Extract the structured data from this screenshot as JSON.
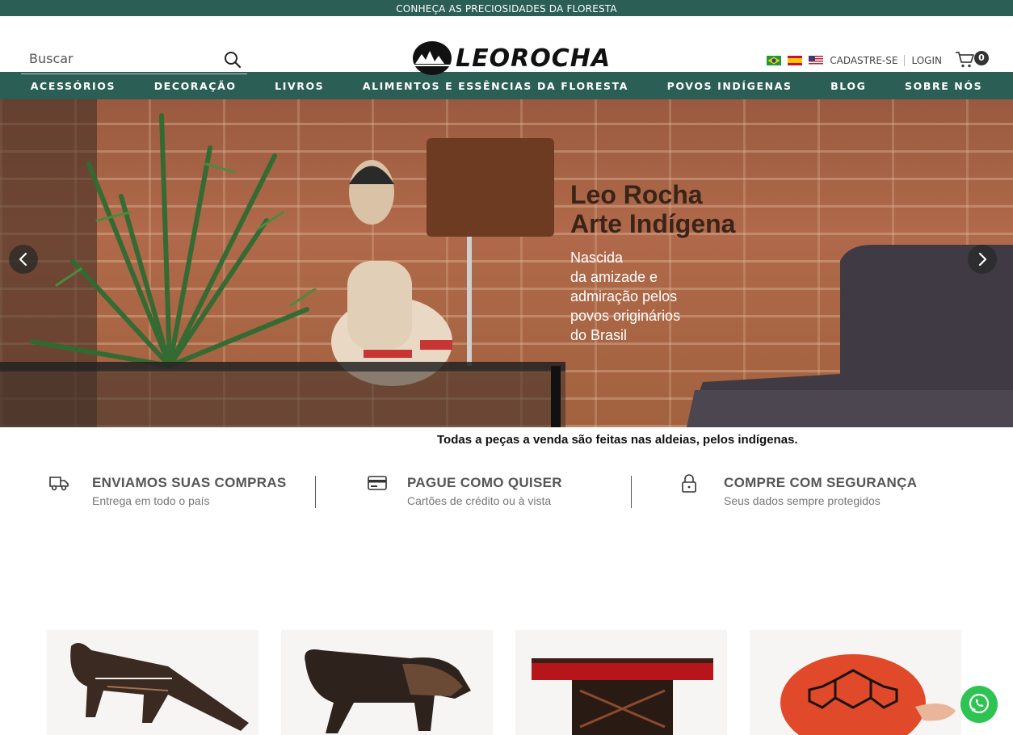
{
  "topbar": {
    "text": "CONHEÇA AS PRECIOSIDADES DA FLORESTA"
  },
  "search": {
    "placeholder": "Buscar"
  },
  "logo": {
    "text": "LEOROCHA"
  },
  "user": {
    "register": "CADASTRE-SE",
    "login": "LOGIN",
    "cart_count": "0"
  },
  "flags": [
    "brazil-flag",
    "spain-flag",
    "usa-flag"
  ],
  "nav": {
    "items": [
      {
        "label": "ACESSÓRIOS"
      },
      {
        "label": "DECORAÇÃO"
      },
      {
        "label": "LIVROS"
      },
      {
        "label": "ALIMENTOS E ESSÊNCIAS DA FLORESTA"
      },
      {
        "label": "POVOS INDÍGENAS"
      },
      {
        "label": "BLOG"
      },
      {
        "label": "SOBRE NÓS"
      }
    ]
  },
  "hero": {
    "title_line1": "Leo Rocha",
    "title_line2": "Arte Indígena",
    "sub_lines": [
      "Nascida",
      "da amizade e",
      "admiração pelos",
      "povos originários",
      "do Brasil"
    ]
  },
  "tagline": "Todas a peças a venda são feitas nas aldeias, pelos indígenas.",
  "features": [
    {
      "title": "ENVIAMOS SUAS COMPRAS",
      "desc": "Entrega em todo o país",
      "icon": "truck-icon"
    },
    {
      "title": "PAGUE COMO QUISER",
      "desc": "Cartões de crédito ou à vista",
      "icon": "credit-card-icon"
    },
    {
      "title": "COMPRE COM SEGURANÇA",
      "desc": "Seus dados sempre protegidos",
      "icon": "lock-icon"
    }
  ],
  "products": [
    "anteater-sculpture",
    "jaguar-sculpture",
    "painted-bench",
    "turtle-sculpture"
  ],
  "colors": {
    "brand_green": "#2b5e55",
    "whatsapp_green": "#2ec452"
  }
}
